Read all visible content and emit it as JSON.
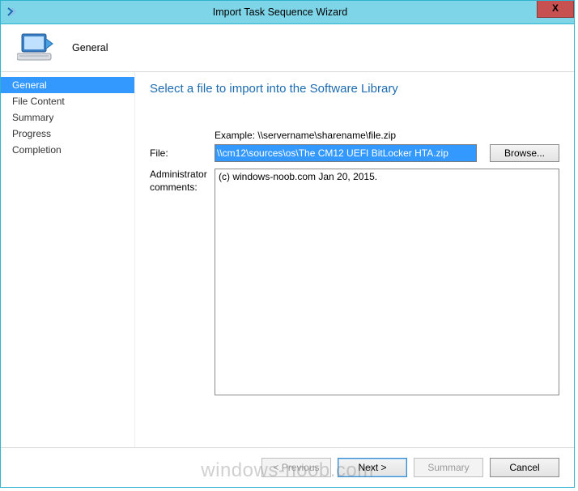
{
  "window": {
    "title": "Import Task Sequence Wizard",
    "close_glyph": "X"
  },
  "header": {
    "page_name": "General"
  },
  "sidebar": {
    "steps": [
      {
        "label": "General",
        "active": true
      },
      {
        "label": "File Content",
        "active": false
      },
      {
        "label": "Summary",
        "active": false
      },
      {
        "label": "Progress",
        "active": false
      },
      {
        "label": "Completion",
        "active": false
      }
    ]
  },
  "content": {
    "heading": "Select a file to import into the Software Library",
    "example_label": "Example: \\\\servername\\sharename\\file.zip",
    "file_label": "File:",
    "file_value": "\\\\cm12\\sources\\os\\The CM12 UEFI BitLocker HTA.zip",
    "browse_label": "Browse...",
    "comments_label": "Administrator comments:",
    "comments_value": "(c) windows-noob.com Jan 20, 2015."
  },
  "footer": {
    "previous": "< Previous",
    "next": "Next >",
    "summary": "Summary",
    "cancel": "Cancel"
  },
  "watermark": "windows-noob.com"
}
